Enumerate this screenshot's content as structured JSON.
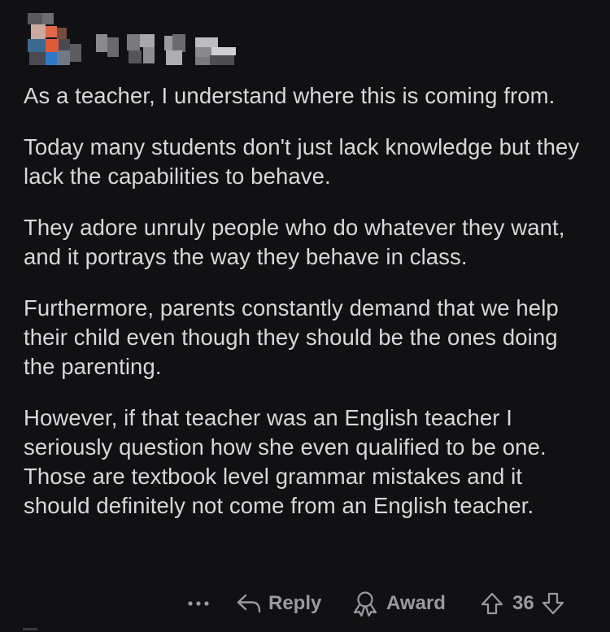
{
  "comment": {
    "paragraphs": [
      "As a teacher, I understand where this is coming from.",
      "Today many students don't just lack knowledge but they lack the capabilities to behave.",
      "They adore unruly people who do whatever they want, and it portrays the way they behave in class.",
      "Furthermore, parents constantly demand that we help their child even though they should be the ones doing the parenting.",
      "However, if that teacher was an English teacher I seriously question how she even qualified to be one. Those are textbook level grammar mistakes and it should definitely not come from an English teacher."
    ]
  },
  "actions": {
    "more_icon": "more-horizontal-icon",
    "reply_label": "Reply",
    "reply_icon": "reply-arrow-icon",
    "award_label": "Award",
    "award_icon": "award-ribbon-icon",
    "upvote_icon": "upvote-arrow-icon",
    "score": "36",
    "downvote_icon": "downvote-arrow-icon"
  },
  "colors": {
    "background": "#111113",
    "text": "#d8d8da",
    "muted": "#9a9ba0"
  }
}
